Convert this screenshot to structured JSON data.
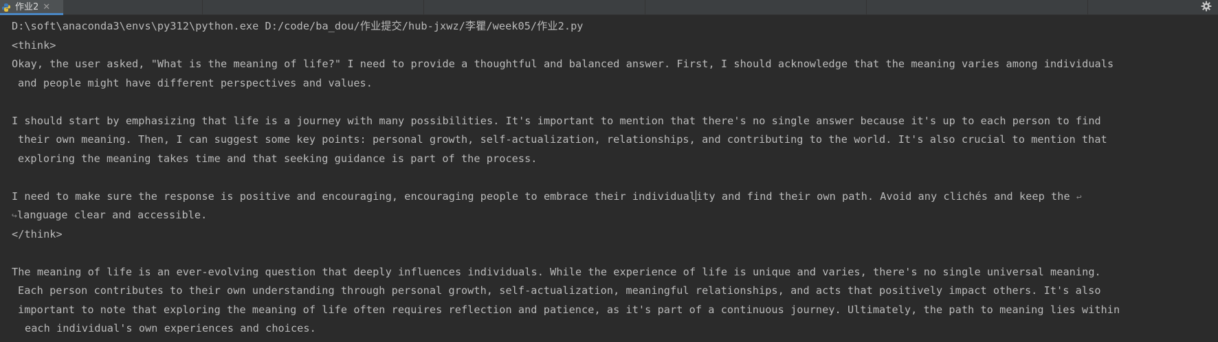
{
  "tab": {
    "title": "作业2",
    "close_glyph": "✕",
    "icon": "python-icon"
  },
  "toolbar": {
    "settings_icon": "gear-icon"
  },
  "console": {
    "command": "D:\\soft\\anaconda3\\envs\\py312\\python.exe D:/code/ba_dou/作业提交/hub-jxwz/李瞿/week05/作业2.py",
    "think_open": "<think>",
    "p1_line1": "Okay, the user asked, \"What is the meaning of life?\" I need to provide a thoughtful and balanced answer. First, I should acknowledge that the meaning varies among individuals",
    "p1_line2": "and people might have different perspectives and values.",
    "p2_line1": "I should start by emphasizing that life is a journey with many possibilities. It's important to mention that there's no single answer because it's up to each person to find",
    "p2_line2": "their own meaning. Then, I can suggest some key points: personal growth, self-actualization, relationships, and contributing to the world. It's also crucial to mention that",
    "p2_line3": "exploring the meaning takes time and that seeking guidance is part of the process.",
    "p3_line1a": "I need to make sure the response is positive and encouraging, encouraging people to embrace their individual",
    "p3_line1b": "ity and find their own path. Avoid any clichés and keep the ",
    "p3_wrap_end": "↩",
    "p3_wrap_start": "↪",
    "p3_line2": "language clear and accessible.",
    "think_close": "</think>",
    "a_line1": "The meaning of life is an ever-evolving question that deeply influences individuals. While the experience of life is unique and varies, there's no single universal meaning.",
    "a_line2": "Each person contributes to their own understanding through personal growth, self-actualization, meaningful relationships, and acts that positively impact others. It's also",
    "a_line3": "important to note that exploring the meaning of life often requires reflection and patience, as it's part of a continuous journey. Ultimately, the path to meaning lies within",
    "a_line4": "each individual's own experiences and choices."
  },
  "colors": {
    "background": "#2b2b2b",
    "text": "#bbbbbb",
    "tabbar": "#3c3f41",
    "tab_active": "#4e5254",
    "accent": "#4a88c7"
  }
}
